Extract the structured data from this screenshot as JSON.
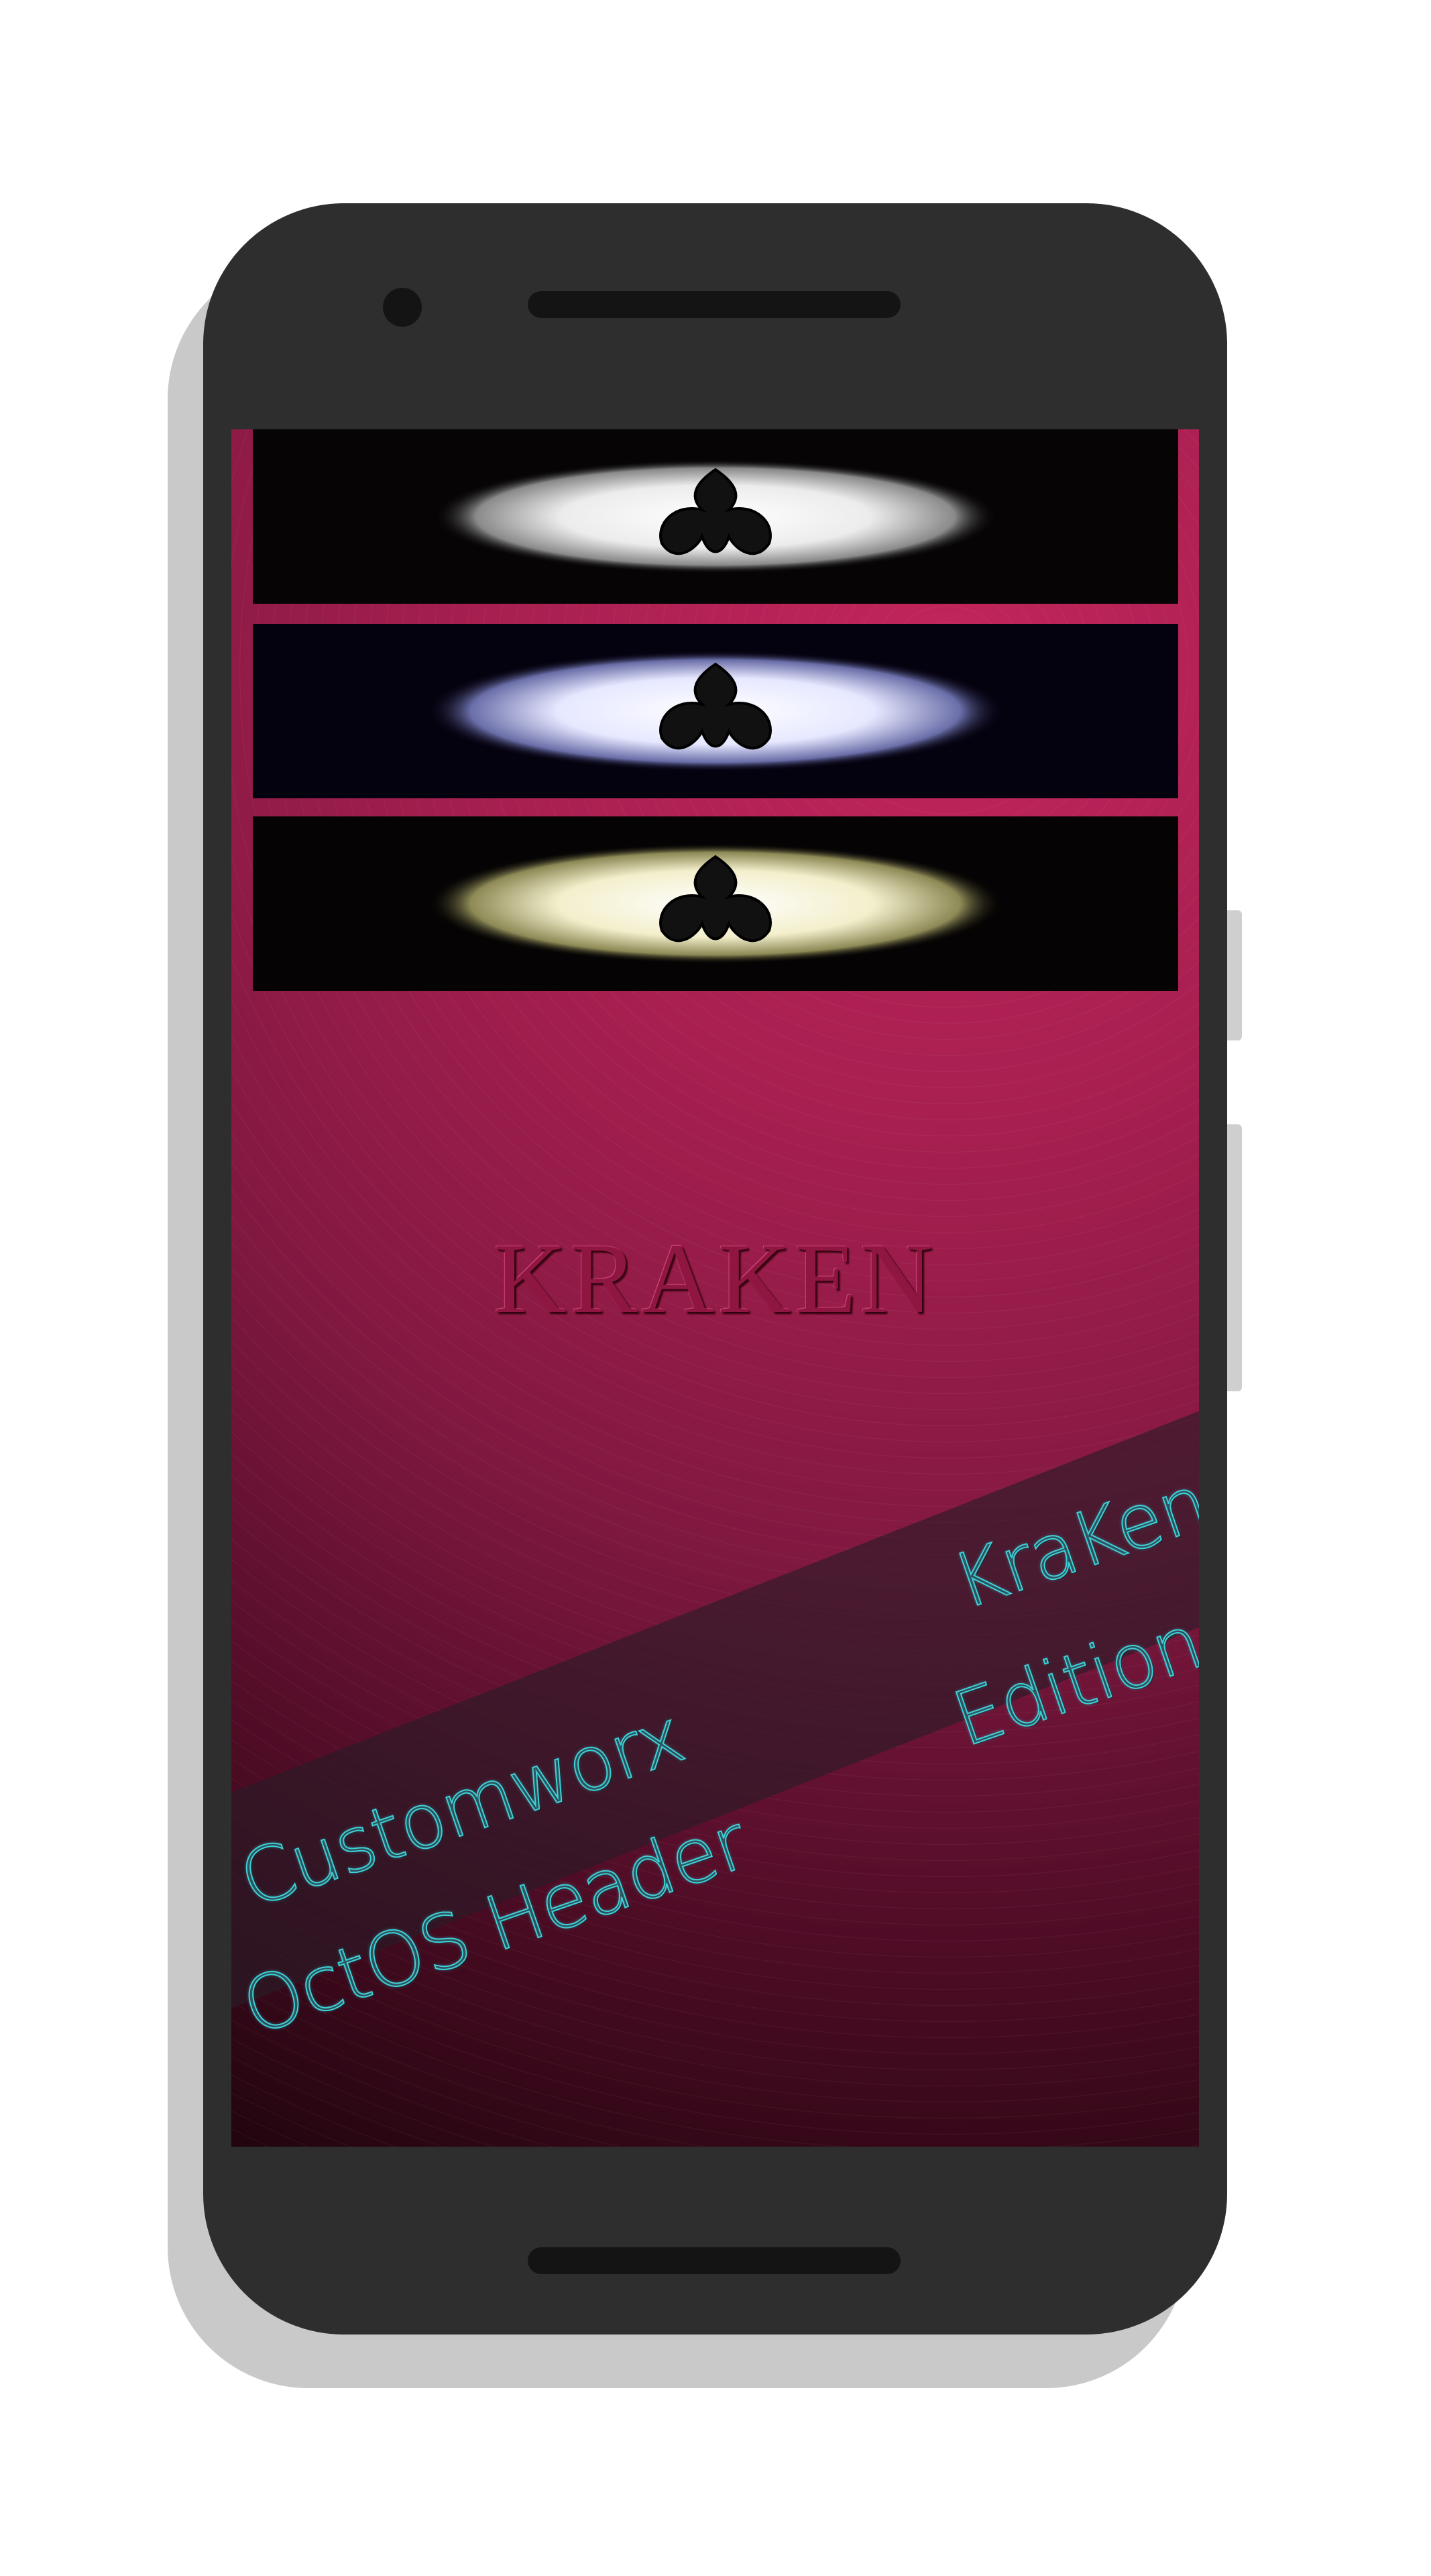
{
  "device": {
    "frame_color": "#2e2e2e",
    "shadow_color": "#c9c9c9"
  },
  "screen": {
    "background_accent": "#c2255c",
    "header_previews": [
      {
        "name": "header-preview-white",
        "glow_color": "#ffffff",
        "background": "#060405"
      },
      {
        "name": "header-preview-blue",
        "glow_color": "#d9dcff",
        "background": "#050210"
      },
      {
        "name": "header-preview-gold",
        "glow_color": "#f5f2c4",
        "background": "#050303"
      }
    ],
    "logo_text": "KRAKEN",
    "banner": {
      "left_line1": "Customworx",
      "left_line2": "OctOS Header",
      "right_line1": "KraKen",
      "right_line2": "Edition",
      "text_color": "#3fd0d8"
    }
  }
}
